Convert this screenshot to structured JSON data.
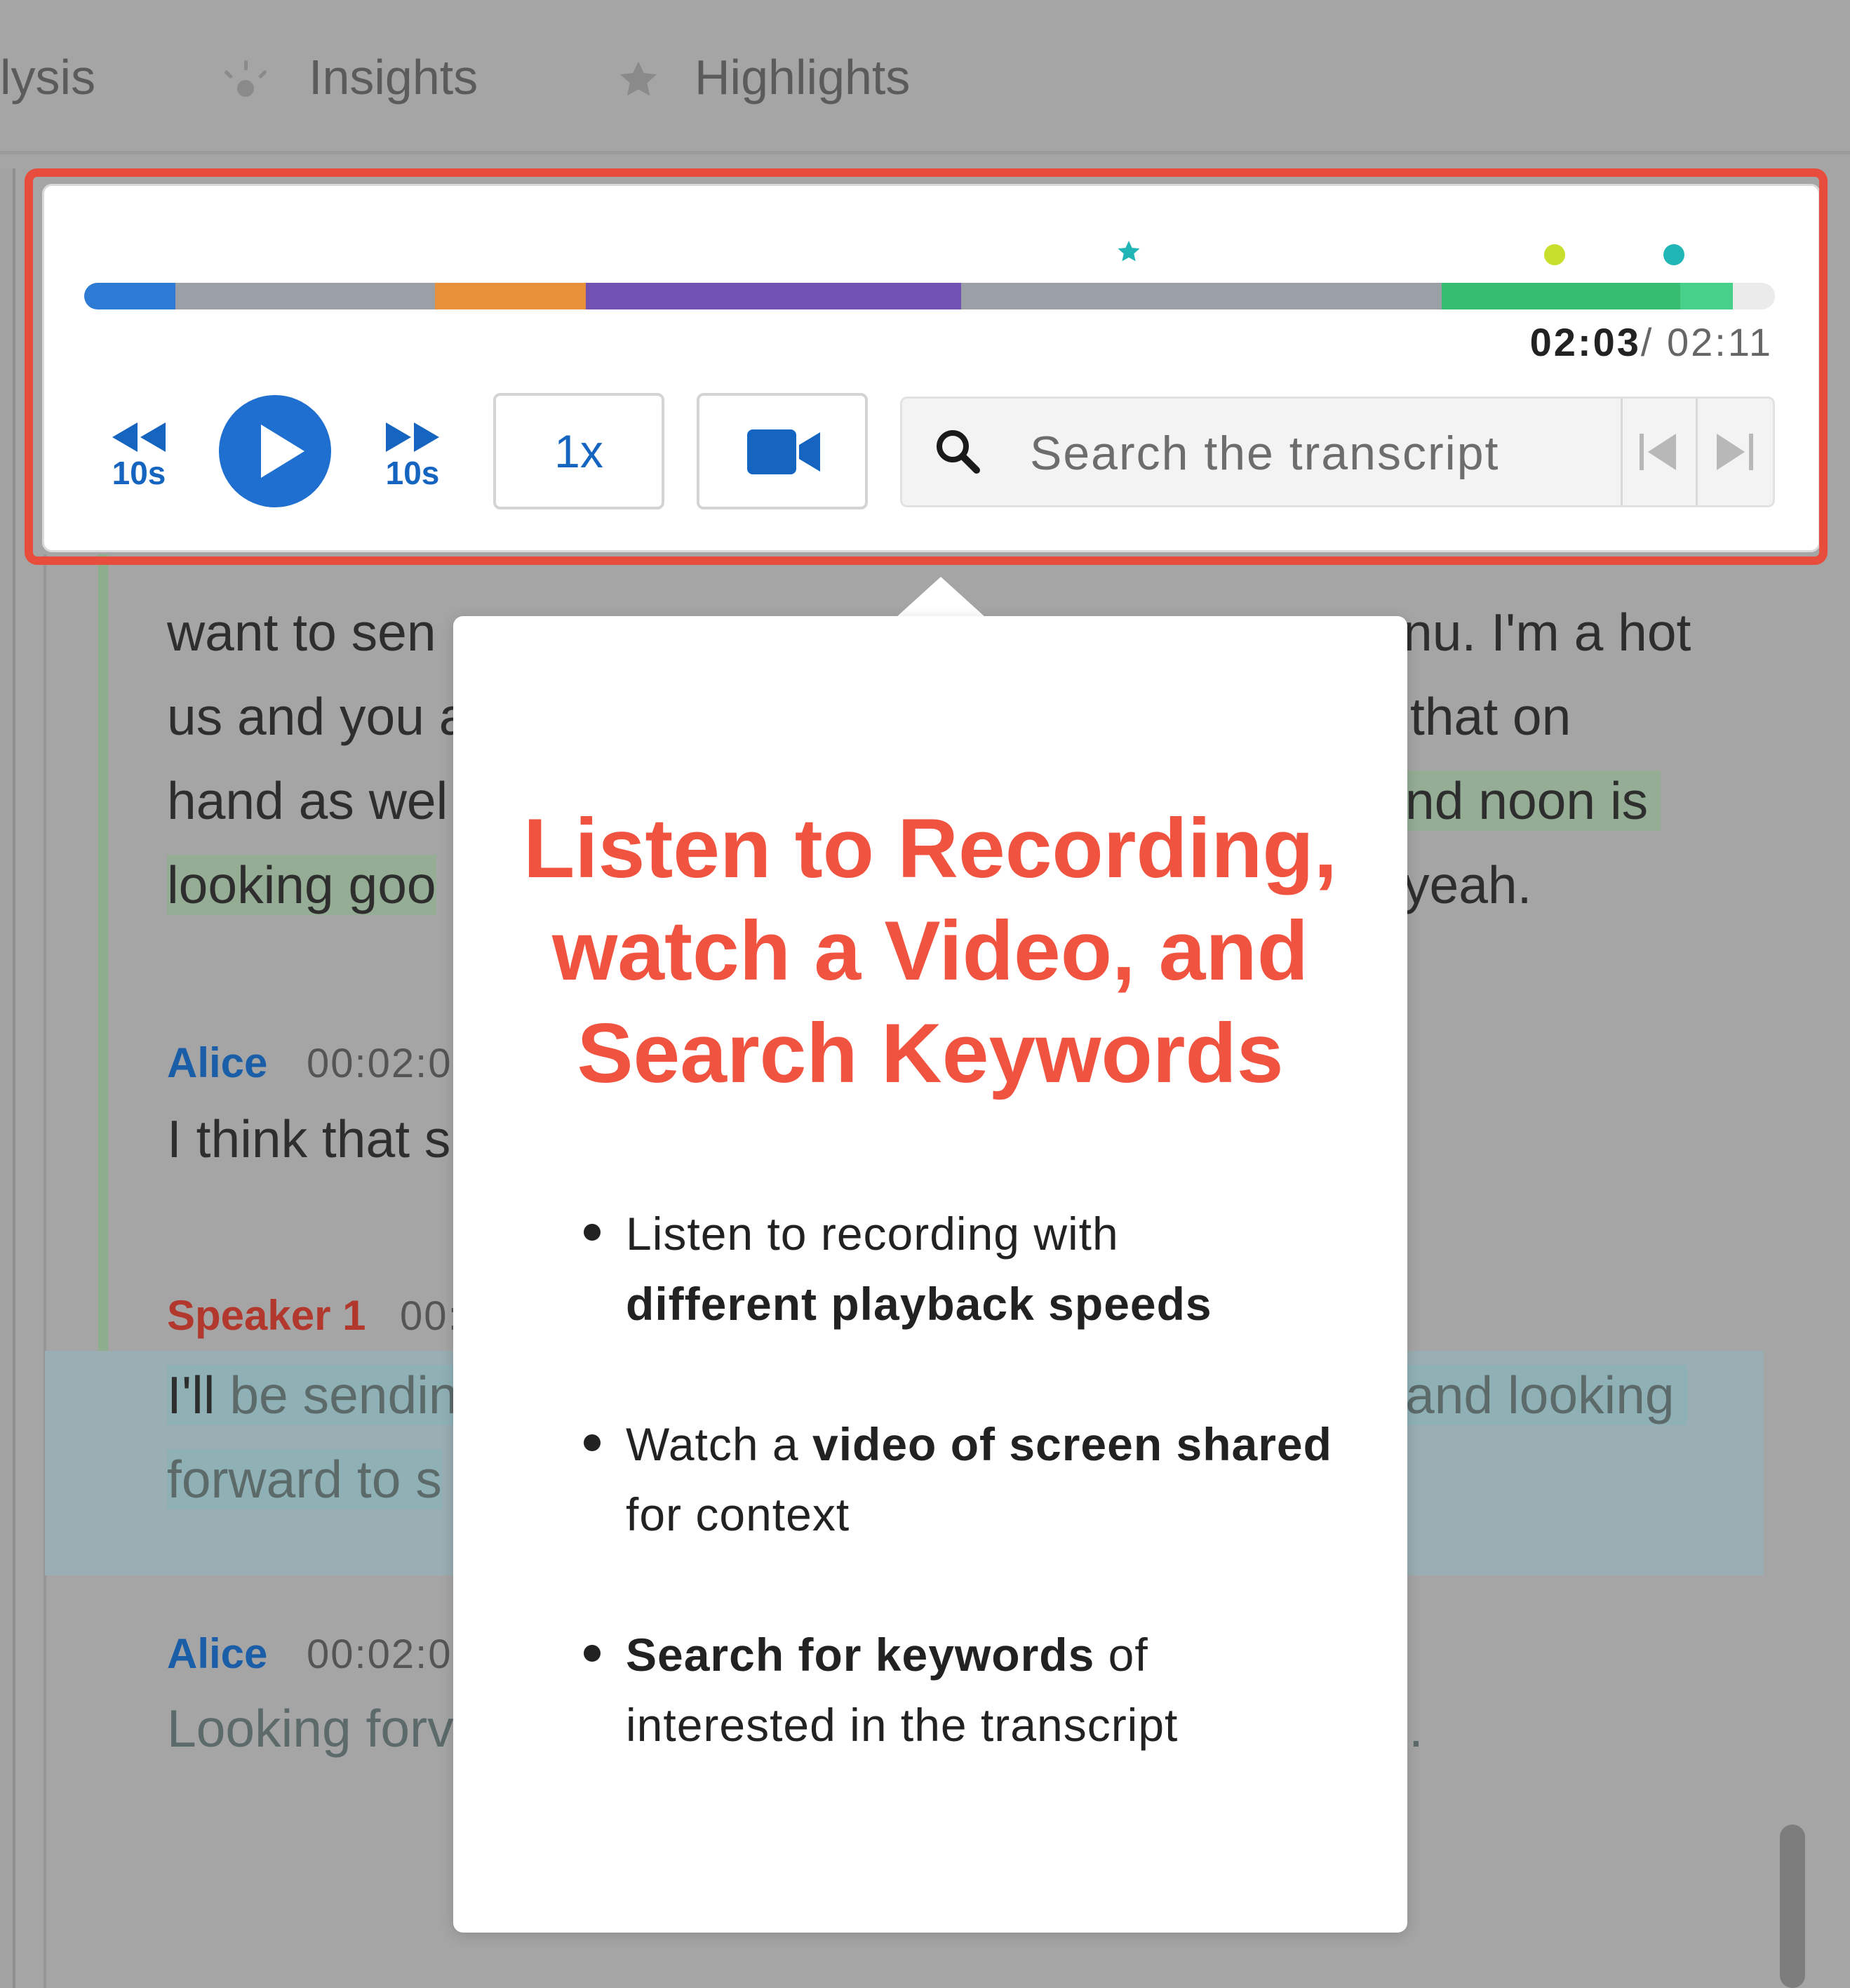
{
  "nav": {
    "tabs": [
      {
        "label": "lysis",
        "icon": ""
      },
      {
        "label": "Insights",
        "icon": "sparkle-icon"
      },
      {
        "label": "Highlights",
        "icon": "star-icon"
      }
    ]
  },
  "player": {
    "current_time": "02:03",
    "total_time": "/ 02:11",
    "rewind_label": "10s",
    "forward_label": "10s",
    "speed": "1x",
    "search_placeholder": "Search the transcript",
    "colors": {
      "accent": "#1e6fd0",
      "highlight_outline": "#e84c3d"
    },
    "segments": [
      {
        "color": "#2e7bd6"
      },
      {
        "color": "#9aa0a6"
      },
      {
        "color": "#e8903a"
      },
      {
        "color": "#6f52b2"
      },
      {
        "color": "#9aa0a6"
      },
      {
        "color": "#36bd72"
      },
      {
        "color": "#47d08a"
      },
      {
        "color": "#ebebeb"
      }
    ]
  },
  "transcript": {
    "lines_top": [
      "want to sen",
      "us and you a",
      "hand as wel",
      "looking goo"
    ],
    "lines_top_right": [
      "nu. I'm a hot",
      "that on",
      "nd noon is",
      "yeah."
    ],
    "entries": [
      {
        "speaker": "Alice",
        "time": "00:02:0",
        "text": "I think that s"
      },
      {
        "speaker": "Speaker 1",
        "time": "00:",
        "text1": "I'll",
        "text1b": " be sendin",
        "text2": "forward to s",
        "right": "and looking"
      },
      {
        "speaker": "Alice",
        "time": "00:02:0",
        "text": "Looking forv",
        "right": "."
      }
    ]
  },
  "popover": {
    "title_lines": [
      "Listen to Recording,",
      "watch a Video, and",
      "Search Keywords"
    ],
    "bullets": [
      {
        "parts": [
          {
            "t": "Listen to recording with "
          },
          {
            "t": "different playback speeds",
            "b": true
          }
        ]
      },
      {
        "parts": [
          {
            "t": "Watch a "
          },
          {
            "t": "video of screen shared",
            "b": true
          },
          {
            "t": " for context"
          }
        ]
      },
      {
        "parts": [
          {
            "t": "Search for keywords",
            "b": true
          },
          {
            "t": " of interested in the transcript"
          }
        ]
      }
    ]
  }
}
